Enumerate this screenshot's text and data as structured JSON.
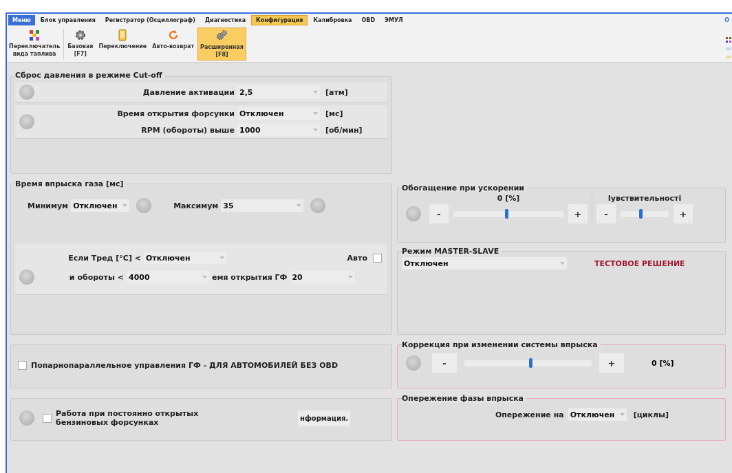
{
  "tabs": [
    {
      "label": "Меню",
      "kind": "menu",
      "selected": false
    },
    {
      "label": "Блок управления",
      "kind": "tab",
      "selected": false
    },
    {
      "label": "Регистратор (Осциллограф)",
      "kind": "tab",
      "selected": false
    },
    {
      "label": "Диагностика",
      "kind": "tab",
      "selected": false
    },
    {
      "label": "Конфигурация",
      "kind": "tab",
      "selected": true
    },
    {
      "label": "Калибровка",
      "kind": "tab",
      "selected": false
    },
    {
      "label": "OBD",
      "kind": "tab",
      "selected": false
    },
    {
      "label": "ЭМУЛ",
      "kind": "tab",
      "selected": false
    }
  ],
  "corner_label": "О",
  "toolbar": [
    {
      "lines": [
        "Переключатель",
        "вида таплива"
      ],
      "selected": false
    },
    {
      "lines": [
        "Базовая",
        "[F7]"
      ],
      "selected": false
    },
    {
      "lines": [
        "Переключение"
      ],
      "selected": false
    },
    {
      "lines": [
        "Авто-возврат"
      ],
      "selected": false
    },
    {
      "lines": [
        "Расширенная",
        "[F8]"
      ],
      "selected": true
    }
  ],
  "cutoff": {
    "title": "Сброс давления в режиме Cut-off",
    "groups": [
      [
        {
          "label": "Давление активации",
          "value": "2,5",
          "unit": "[атм]"
        }
      ],
      [
        {
          "label": "Время открытия форсунки",
          "value": "Отключен",
          "unit": "[мс]"
        },
        {
          "label": "RPM (обороты) выше",
          "value": "1000",
          "unit": "[об/мин]"
        }
      ]
    ]
  },
  "gas_time": {
    "title": "Время впрыска газа [мс]",
    "min": {
      "label": "Минимум",
      "value": "Отключен"
    },
    "max": {
      "label": "Максимум",
      "value": "35"
    },
    "temp": {
      "label": "Если Тред [°C] <",
      "value": "Отключен"
    },
    "auto": {
      "label": "Авто",
      "checked": false
    },
    "rpm": {
      "label": "и обороты <",
      "value": "4000"
    },
    "open_time": {
      "label": "емя открытия ГФ",
      "value": "20"
    }
  },
  "enrichment": {
    "title": "Обогащение при ускорении",
    "reading": "0  [%]",
    "level": 0.48,
    "minus": "-",
    "plus": "+",
    "sensitivity": {
      "label": "Іувствительності",
      "level": 0.42,
      "minus": "-",
      "plus": "+"
    }
  },
  "master_slave": {
    "title": "Режим MASTER-SLAVE",
    "value": "Отключен",
    "note": "ТЕСТОВОЕ РЕШЕНИЕ"
  },
  "paired": {
    "label": "Попарнопараллельное управления ГФ - ДЛЯ АВТОМОБИЛЕЙ БЕЗ OBD",
    "checked": false
  },
  "correction": {
    "title": "Коррекция при изменении системы впрыска",
    "minus": "-",
    "plus": "+",
    "level": 0.52,
    "reading": "0  [%]"
  },
  "open_injectors": {
    "label": "Работа при постоянно открытых бензиновых форсунках",
    "checked": false,
    "button": "нформация."
  },
  "phase": {
    "title": "Опережение фазы впрыска",
    "label": "Опережение на",
    "value": "Отключен",
    "unit": "[циклы]"
  }
}
